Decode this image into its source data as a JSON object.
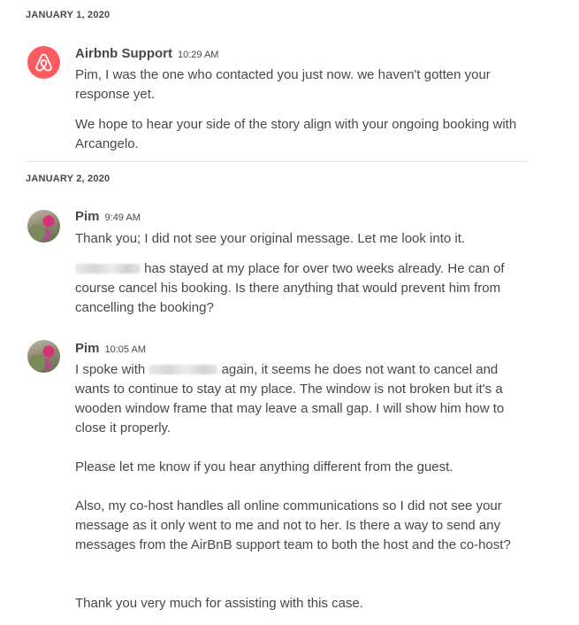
{
  "dates": {
    "first": "JANUARY 1, 2020",
    "second": "JANUARY 2, 2020"
  },
  "messages": [
    {
      "sender": "Airbnb Support",
      "time": "10:29 AM",
      "avatar_icon": "airbnb-logo-icon",
      "paragraphs": [
        "Pim, I was the one who contacted you just now. we haven't gotten your response yet.",
        "We hope to hear your side of the story align with your ongoing booking with Arcangelo."
      ]
    },
    {
      "sender": "Pim",
      "time": "9:49 AM",
      "avatar_icon": "user-photo-avatar",
      "paragraphs": [
        "Thank you; I did not see your original message. Let me look into it.",
        "has stayed at my place for over two weeks already. He can of course cancel his booking. Is there anything that would prevent him from cancelling the booking?"
      ]
    },
    {
      "sender": "Pim",
      "time": "10:05 AM",
      "avatar_icon": "user-photo-avatar",
      "paragraphs": [
        "I spoke with",
        "again, it seems he does not want to cancel and wants to continue to stay at my place. The window is not broken but it's a wooden window frame that may leave a small gap. I will show him how to close it properly.",
        "Please let me know if you hear anything different from the guest.",
        "Also, my co-host handles all online communications so I did not see your message as it only went to me and not to her. Is there a way to send any messages from the AirBnB support team to both the host and the co-host?",
        "Thank you very much for assisting with this case."
      ]
    }
  ],
  "colors": {
    "text": "#484848",
    "brand": "#ff5a5f",
    "divider": "#e4e4e4"
  }
}
